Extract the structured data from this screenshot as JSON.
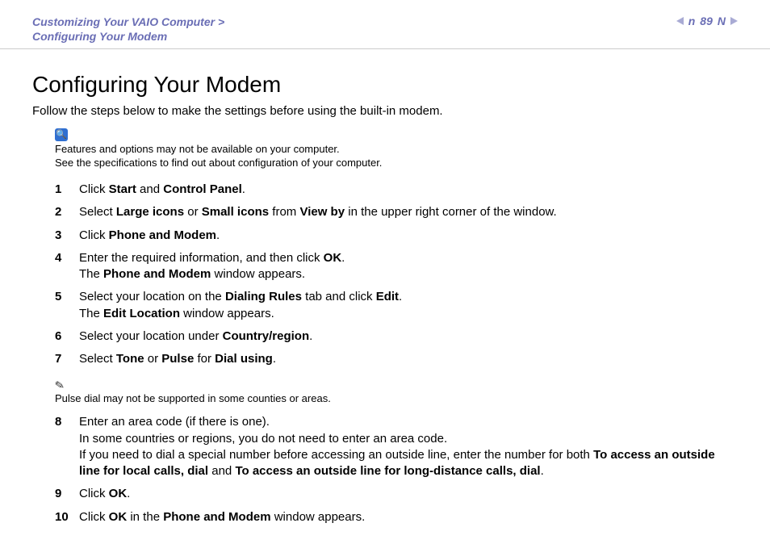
{
  "header": {
    "breadcrumb_line1": "Customizing Your VAIO Computer >",
    "breadcrumb_line2": "Configuring Your Modem",
    "page_number": "89",
    "letter": "n",
    "capital_n": "N"
  },
  "title": "Configuring Your Modem",
  "intro": "Follow the steps below to make the settings before using the built-in modem.",
  "info_note": {
    "line1": "Features and options may not be available on your computer.",
    "line2": "See the specifications to find out about configuration of your computer."
  },
  "steps": {
    "s1": {
      "pre": "Click ",
      "b1": "Start",
      "mid": " and ",
      "b2": "Control Panel",
      "post": "."
    },
    "s2": {
      "pre": "Select ",
      "b1": "Large icons",
      "mid1": " or ",
      "b2": "Small icons",
      "mid2": " from ",
      "b3": "View by",
      "post": " in the upper right corner of the window."
    },
    "s3": {
      "pre": "Click ",
      "b1": "Phone and Modem",
      "post": "."
    },
    "s4": {
      "line1_pre": "Enter the required information, and then click ",
      "line1_b": "OK",
      "line1_post": ".",
      "line2_pre": "The ",
      "line2_b": "Phone and Modem",
      "line2_post": " window appears."
    },
    "s5": {
      "line1_pre": "Select your location on the ",
      "line1_b1": "Dialing Rules",
      "line1_mid": " tab and click ",
      "line1_b2": "Edit",
      "line1_post": ".",
      "line2_pre": "The ",
      "line2_b": "Edit Location",
      "line2_post": " window appears."
    },
    "s6": {
      "pre": "Select your location under ",
      "b1": "Country/region",
      "post": "."
    },
    "s7": {
      "pre": "Select ",
      "b1": "Tone",
      "mid1": " or ",
      "b2": "Pulse",
      "mid2": " for ",
      "b3": "Dial using",
      "post": "."
    },
    "s8": {
      "line1": "Enter an area code (if there is one).",
      "line2": "In some countries or regions, you do not need to enter an area code.",
      "line3_pre": "If you need to dial a special number before accessing an outside line, enter the number for both ",
      "line3_b1": "To access an outside line for local calls, dial",
      "line3_mid": " and ",
      "line3_b2": "To access an outside line for long-distance calls, dial",
      "line3_post": "."
    },
    "s9": {
      "pre": "Click ",
      "b1": "OK",
      "post": "."
    },
    "s10": {
      "pre": "Click ",
      "b1": "OK",
      "mid": " in the ",
      "b2": "Phone and Modem",
      "post": " window appears."
    }
  },
  "footnote": "Pulse dial may not be supported in some counties or areas."
}
